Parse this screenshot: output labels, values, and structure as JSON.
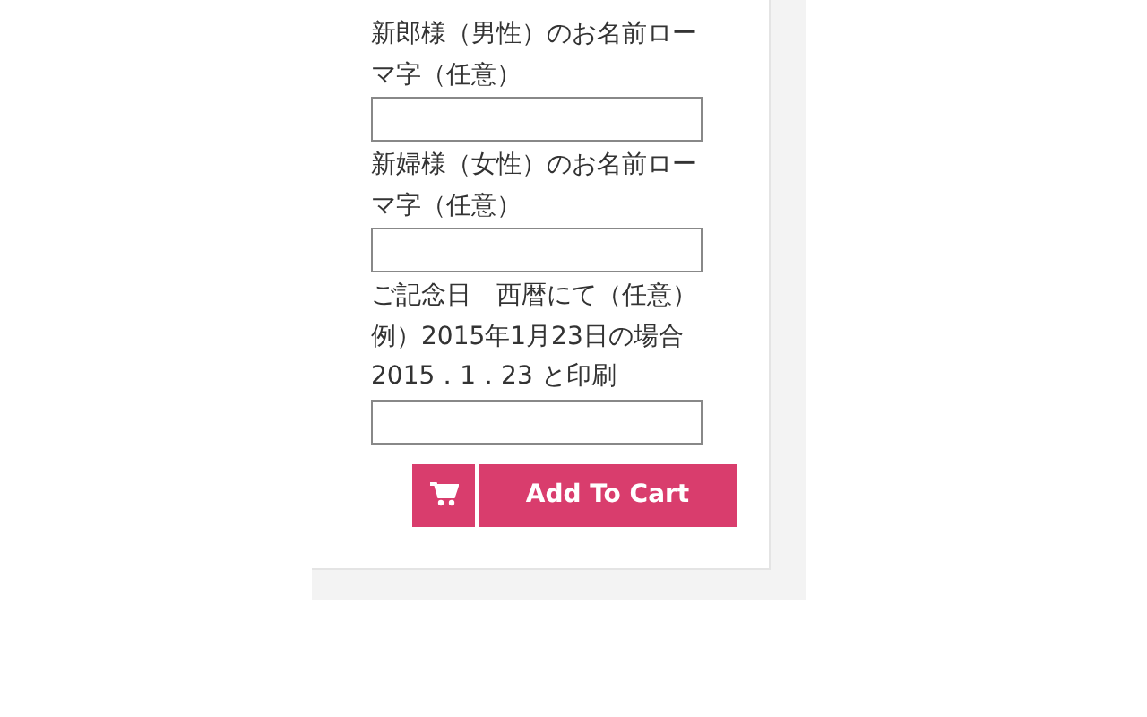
{
  "fields": [
    {
      "label_lines": [
        "新郎様（男性）のお名前ローマ字（任意）"
      ]
    },
    {
      "label_lines": [
        "新婦様（女性）のお名前ローマ字（任意）"
      ]
    },
    {
      "label_lines": [
        "ご記念日　西暦にて（任意）",
        "例）2015年1月23日の場合",
        "2015．1．23 と印刷"
      ]
    }
  ],
  "add_to_cart": {
    "label": "Add To Cart"
  }
}
